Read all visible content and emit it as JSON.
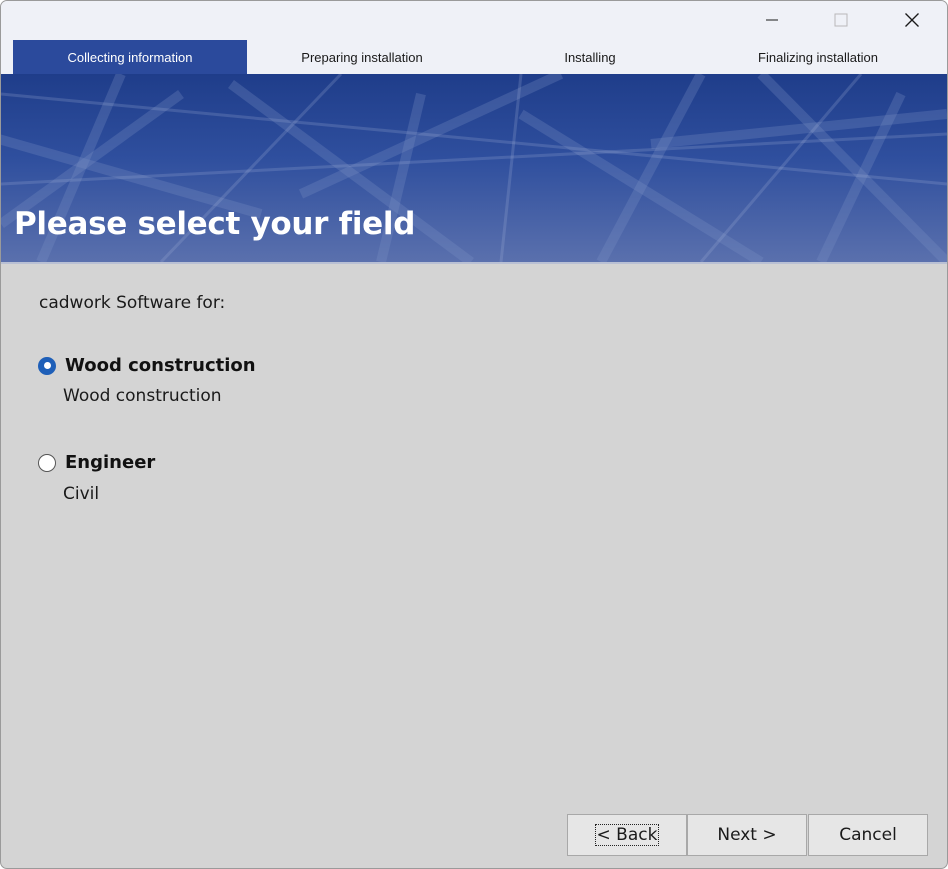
{
  "window": {
    "controls": {
      "minimize_icon": "minimize-icon",
      "maximize_icon": "maximize-icon",
      "close_icon": "close-icon"
    }
  },
  "steps": [
    {
      "label": "Collecting information",
      "active": true
    },
    {
      "label": "Preparing installation",
      "active": false
    },
    {
      "label": "Installing",
      "active": false
    },
    {
      "label": "Finalizing installation",
      "active": false
    }
  ],
  "banner": {
    "title": "Please select your field"
  },
  "content": {
    "label": "cadwork Software for:",
    "options": [
      {
        "title": "Wood construction",
        "description": "Wood construction",
        "selected": true
      },
      {
        "title": "Engineer",
        "description": "Civil",
        "selected": false
      }
    ]
  },
  "buttons": {
    "back": "< Back",
    "next": "Next >",
    "cancel": "Cancel"
  },
  "colors": {
    "accent": "#2b4a9c",
    "radio_selected": "#1e5fb8",
    "background": "#d4d4d4"
  }
}
